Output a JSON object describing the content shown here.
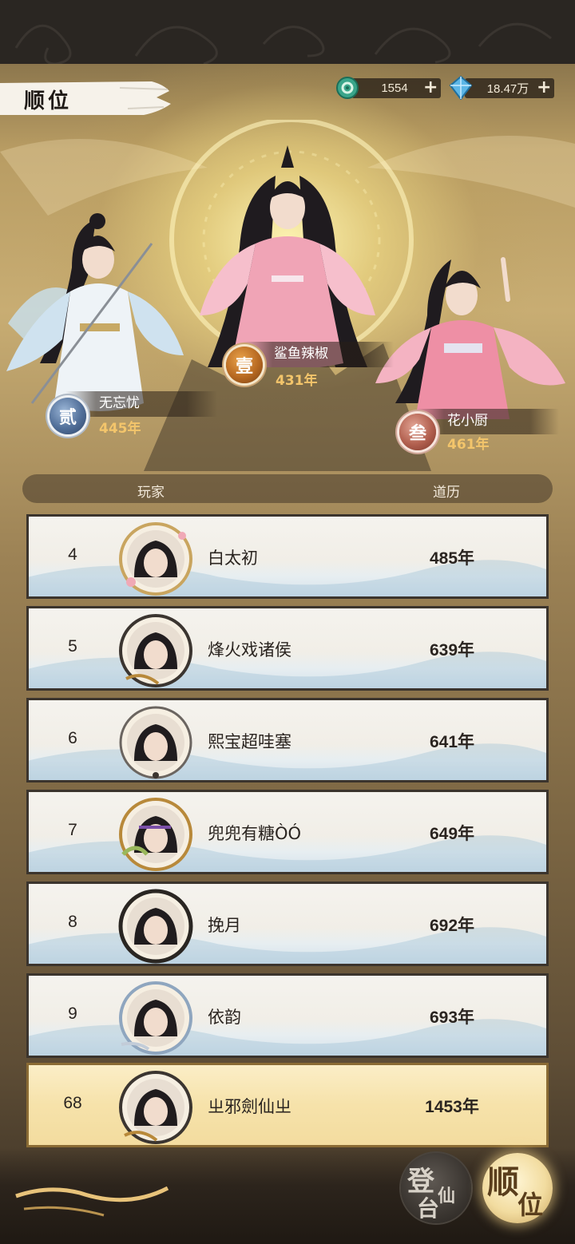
{
  "header": {
    "title": "顺位",
    "currencies": [
      {
        "icon": "jade-coin-icon",
        "value": "1554"
      },
      {
        "icon": "spirit-crystal-icon",
        "value": "18.47万"
      }
    ],
    "plus": "+"
  },
  "podium": [
    {
      "place": "first",
      "medal": "壹",
      "name": "鲨鱼辣椒",
      "years": "431年"
    },
    {
      "place": "second",
      "medal": "贰",
      "name": "无忘忧",
      "years": "445年"
    },
    {
      "place": "third",
      "medal": "叁",
      "name": "花小厨",
      "years": "461年"
    }
  ],
  "columns": {
    "player": "玩家",
    "years": "道历"
  },
  "rows": [
    {
      "rank": "4",
      "name": "白太初",
      "years": "485年"
    },
    {
      "rank": "5",
      "name": "烽火戏诸侯",
      "years": "639年"
    },
    {
      "rank": "6",
      "name": "熙宝超哇塞",
      "years": "641年"
    },
    {
      "rank": "7",
      "name": "兜兜有糖ÒÓ",
      "years": "649年"
    },
    {
      "rank": "8",
      "name": "挽月",
      "years": "692年"
    },
    {
      "rank": "9",
      "name": "依韵",
      "years": "693年"
    }
  ],
  "my_row": {
    "rank": "68",
    "name": "ㄓ邪劍仙ㄓ",
    "years": "1453年"
  },
  "nav": {
    "ascend": {
      "t1": "登",
      "t2": "仙",
      "t3": "台"
    },
    "rank": {
      "t1": "顺",
      "t2": "位"
    }
  }
}
